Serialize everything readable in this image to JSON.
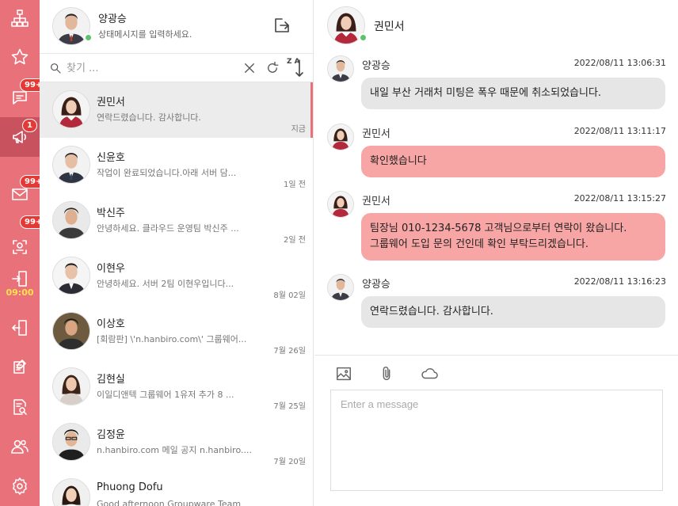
{
  "rail": {
    "badges": {
      "messages": "99+",
      "notice": "1",
      "mail": "99+",
      "rec": "99+"
    },
    "clock": "09:00"
  },
  "me": {
    "name": "양광승",
    "status_placeholder": "상태메시지를 입력하세요."
  },
  "search": {
    "placeholder": "찾기 ..."
  },
  "sort": {
    "label": "Z A"
  },
  "conversations": [
    {
      "name": "권민서",
      "preview": "연락드렸습니다. 감사합니다.",
      "time": "지금"
    },
    {
      "name": "신윤호",
      "preview": "작업이 완료되었습니다.아래 서버 담...",
      "time": "1일 전"
    },
    {
      "name": "박신주",
      "preview": "안녕하세요. 클라우드 운영팀 박신주 ...",
      "time": "2일 전"
    },
    {
      "name": "이현우",
      "preview": "안녕하세요. 서버 2팀 이현우입니다...",
      "time": "8월 02일"
    },
    {
      "name": "이상호",
      "preview": "[회람판] \\'n.hanbiro.com\\' 그룹웨어...",
      "time": "7월 26일"
    },
    {
      "name": "김현실",
      "preview": "이일디앤텍 그룹웨어 1유저 추가 8 ...",
      "time": "7월 25일"
    },
    {
      "name": "김정윤",
      "preview": "n.hanbiro.com 메일 공지 n.hanbiro....",
      "time": "7월 20일"
    },
    {
      "name": "Phuong Dofu",
      "preview": "Good afternoon Groupware Team",
      "time": ""
    }
  ],
  "chat": {
    "title": "권민서",
    "messages": [
      {
        "sender": "양광승",
        "time": "2022/08/11 13:06:31",
        "lines": [
          "내일 부산 거래처 미팅은 폭우 때문에 취소되었습니다."
        ]
      },
      {
        "sender": "권민서",
        "time": "2022/08/11 13:11:17",
        "lines": [
          "확인했습니다"
        ]
      },
      {
        "sender": "권민서",
        "time": "2022/08/11 13:15:27",
        "lines": [
          "팀장님 010-1234-5678 고객님으로부터 연락이 왔습니다.",
          "그룹웨어 도입 문의 건인데 확인 부탁드리겠습니다."
        ]
      },
      {
        "sender": "양광승",
        "time": "2022/08/11 13:16:23",
        "lines": [
          "연락드렸습니다. 감사합니다."
        ]
      }
    ],
    "composer_placeholder": "Enter a message"
  },
  "colors": {
    "rail": "#e8717a",
    "rail_active": "#c8525d",
    "bubble_mine": "#e6e6e6",
    "bubble_theirs": "#f8a5a5",
    "online": "#5cc36b",
    "badge": "#e53935"
  },
  "icons": {
    "rail": [
      "org-chart-icon",
      "star-icon",
      "chat-icon",
      "megaphone-icon",
      "mail-icon",
      "rec-icon",
      "clock-in-icon",
      "clock-out-icon",
      "memo-icon",
      "search-doc-icon",
      "people-icon",
      "gear-icon"
    ],
    "composer_tools": [
      "image-icon",
      "attachment-icon",
      "cloud-icon"
    ]
  }
}
